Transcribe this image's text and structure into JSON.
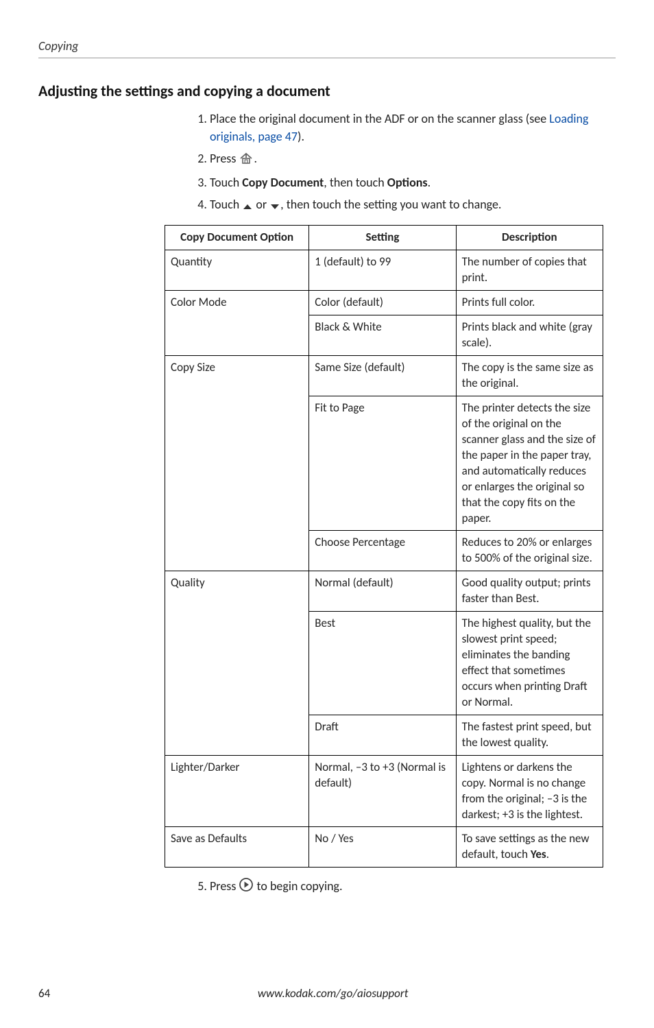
{
  "header": {
    "chapter": "Copying"
  },
  "section": {
    "title": "Adjusting the settings and copying a document"
  },
  "steps": {
    "s1a": "Place the original document in the ADF or on the scanner glass (see ",
    "s1link": "Loading originals, page 47",
    "s1b": ").",
    "s2a": "Press ",
    "s2b": ".",
    "s3a": "Touch ",
    "s3b": "Copy Document",
    "s3c": ", then touch ",
    "s3d": "Options",
    "s3e": ".",
    "s4a": "Touch ",
    "s4b": " or ",
    "s4c": ", then touch the setting you want to change.",
    "s5a": "Press ",
    "s5b": " to begin copying."
  },
  "table": {
    "headers": [
      "Copy Document Option",
      "Setting",
      "Description"
    ],
    "rows": [
      {
        "option": "Quantity",
        "setting": "1 (default) to 99",
        "desc": "The number of copies that print."
      },
      {
        "option": "Color Mode",
        "setting": "Color (default)",
        "desc": "Prints full color."
      },
      {
        "option": "",
        "setting": "Black & White",
        "desc": "Prints black and white (gray scale)."
      },
      {
        "option": "Copy Size",
        "setting": "Same Size (default)",
        "desc": "The copy is the same size as the original."
      },
      {
        "option": "",
        "setting": "Fit to Page",
        "desc": "The printer detects the size of the original on the scanner glass and the size of the paper in the paper tray, and automatically reduces or enlarges the original so that the copy fits on the paper."
      },
      {
        "option": "",
        "setting": "Choose Percentage",
        "desc": "Reduces to 20% or enlarges to 500% of the original size."
      },
      {
        "option": "Quality",
        "setting": "Normal (default)",
        "desc": "Good quality output; prints faster than Best."
      },
      {
        "option": "",
        "setting": "Best",
        "desc": "The highest quality, but the slowest print speed; eliminates the banding effect that sometimes occurs when printing Draft or Normal."
      },
      {
        "option": "",
        "setting": "Draft",
        "desc": "The fastest print speed, but the lowest quality."
      },
      {
        "option": "Lighter/Darker",
        "setting": "Normal, –3 to +3 (Normal is default)",
        "desc": "Lightens or darkens the copy. Normal is no change from the original; –3 is the darkest; +3 is the lightest."
      },
      {
        "option": "Save as Defaults",
        "setting": "No / Yes",
        "desc_a": "To save settings as the new default, touch ",
        "desc_bold": "Yes",
        "desc_b": "."
      }
    ]
  },
  "footer": {
    "page": "64",
    "url": "www.kodak.com/go/aiosupport"
  },
  "rowspans": {
    "r1": 1,
    "r2": 2,
    "r4": 3,
    "r7": 3,
    "r10": 1,
    "r11": 1
  }
}
